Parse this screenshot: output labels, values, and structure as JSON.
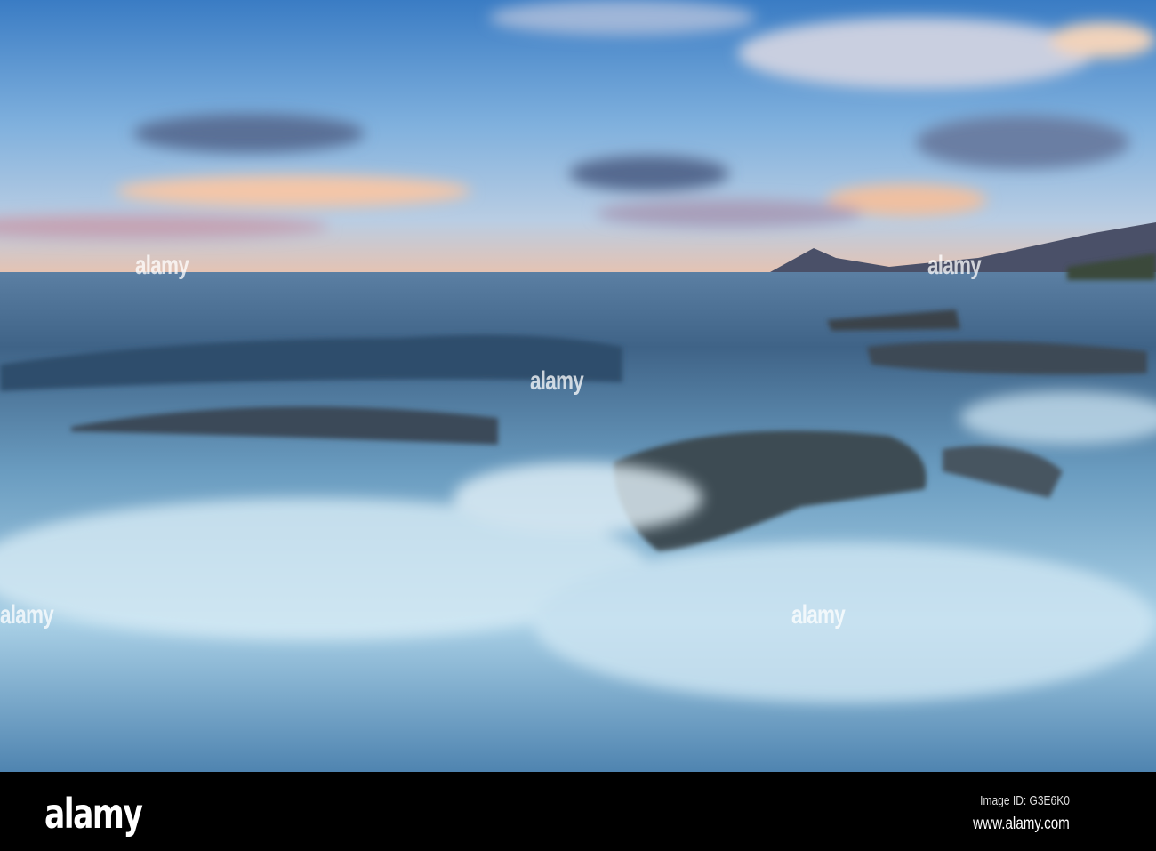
{
  "watermark": {
    "text": "alamy"
  },
  "footer": {
    "logo": "alamy",
    "image_id": "Image ID: G3E6K0",
    "website": "www.alamy.com"
  },
  "colors": {
    "sky_top": "#3f82c9",
    "sky_mid": "#8fb9e0",
    "horizon": "#e8b8a0",
    "sea_dark": "#2b4a6a",
    "foam": "#c9e2f0"
  }
}
